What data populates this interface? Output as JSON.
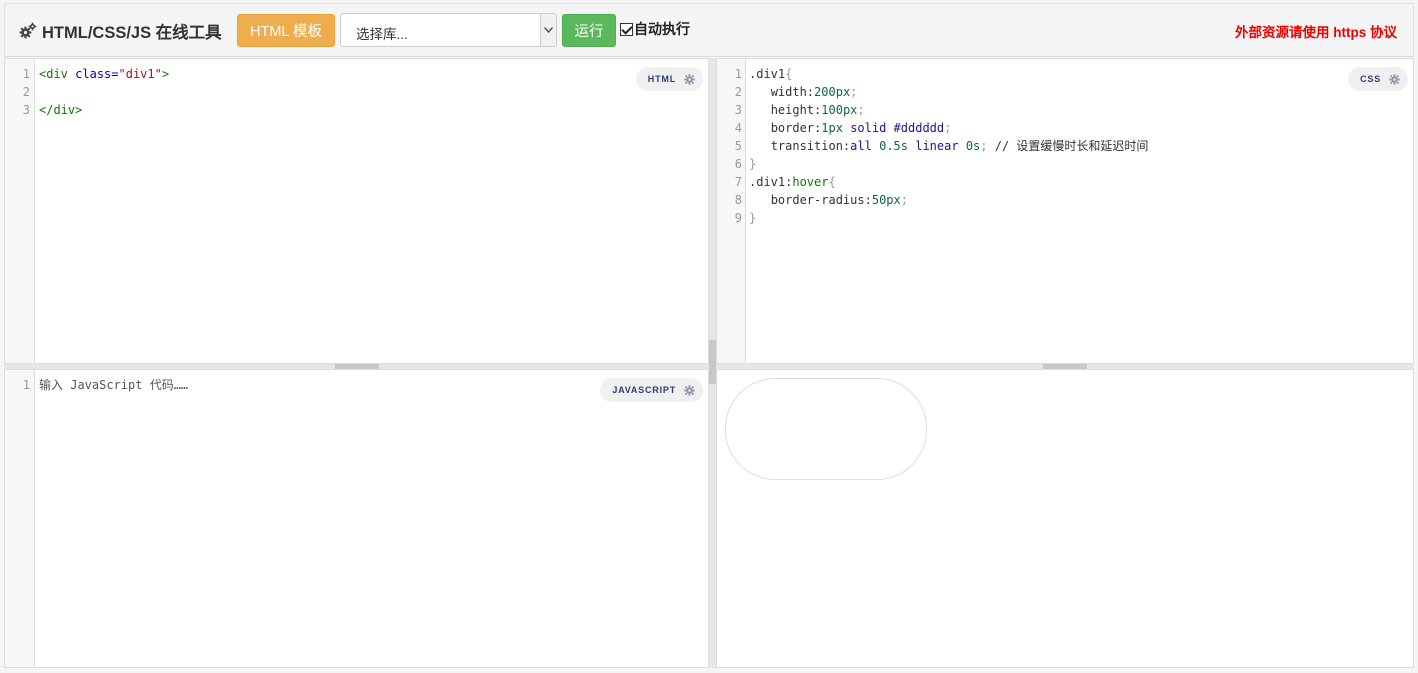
{
  "header": {
    "title": "HTML/CSS/JS 在线工具",
    "template_button": "HTML 模板",
    "library_select_placeholder": "选择库...",
    "run_button": "运行",
    "autorun_label": "自动执行",
    "autorun_checked": true,
    "notice": "外部资源请使用 https 协议",
    "colors": {
      "template": "#f0ad4e",
      "run": "#5cb85c",
      "notice": "#ee0000"
    }
  },
  "editors": {
    "html": {
      "badge": "HTML",
      "line_numbers": [
        "1",
        "2",
        "3"
      ]
    },
    "css": {
      "badge": "CSS",
      "line_numbers": [
        "1",
        "2",
        "3",
        "4",
        "5",
        "6",
        "7",
        "8",
        "9"
      ],
      "comment": "// 设置缓慢时长和延迟时间"
    },
    "js": {
      "badge": "JAVASCRIPT",
      "line_numbers": [
        "1"
      ],
      "placeholder": "输入 JavaScript 代码……"
    }
  },
  "icons": {
    "brand": "cogs-icon",
    "badge": "gear-icon",
    "select": "chevron-down-icon",
    "checkbox": "checkmark-icon"
  }
}
